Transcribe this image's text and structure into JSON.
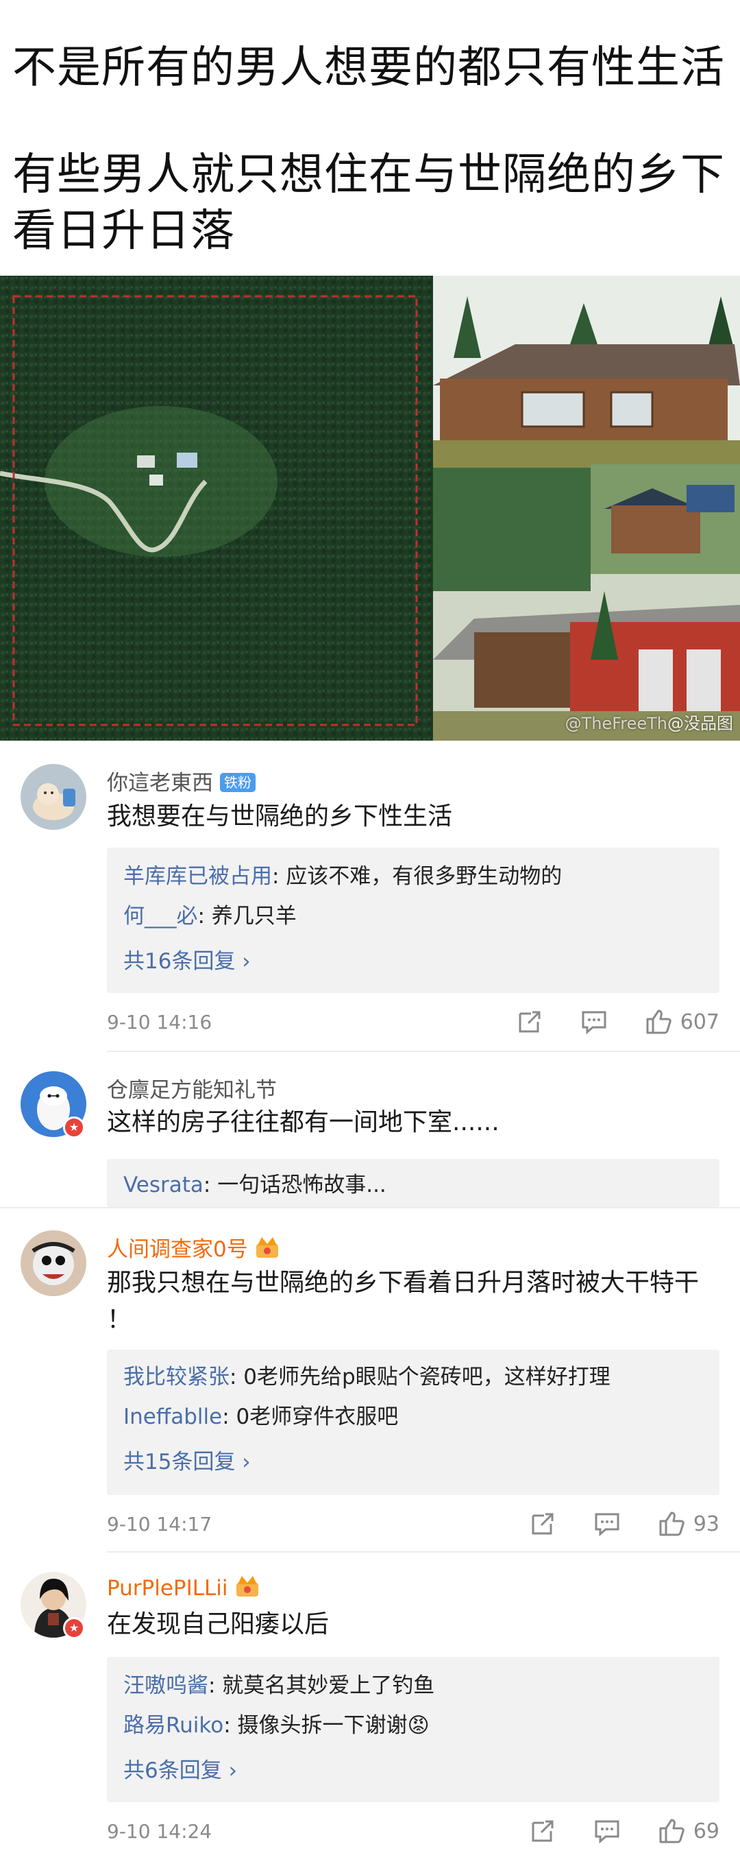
{
  "post": {
    "title_line1": "不是所有的男人想要的都只有性生活",
    "title_line2": "有些男人就只想住在与世隔绝的乡下",
    "title_line3": "看日升日落",
    "watermark_prefix": "@TheFreeTh",
    "watermark_brand": "@没品图"
  },
  "comments": [
    {
      "user": "你這老東西",
      "badge": "铁粉",
      "text": "我想要在与世隔绝的乡下性生活",
      "replies": [
        {
          "user": "羊库库已被占用",
          "text": ": 应该不难，有很多野生动物的"
        },
        {
          "user": "何___必",
          "text": ": 养几只羊"
        }
      ],
      "more": "共16条回复 ›",
      "time": "9-10 14:16",
      "likes": "607"
    },
    {
      "user": "仓廪足方能知礼节",
      "text": "这样的房子往往都有一间地下室......",
      "replies": [
        {
          "user": "Vesrata",
          "text": ": 一句话恐怖故事..."
        }
      ]
    },
    {
      "user": "人间调查家0号",
      "text": "那我只想在与世隔绝的乡下看着日升月落时被大干特干 ！",
      "replies": [
        {
          "user": "我比较紧张",
          "text": ": 0老师先给p眼贴个瓷砖吧，这样好打理"
        },
        {
          "user": "Ineffablle",
          "text": ": 0老师穿件衣服吧"
        }
      ],
      "more": "共15条回复 ›",
      "time": "9-10 14:17",
      "likes": "93"
    },
    {
      "user": "PurPlePILLii",
      "text": "在发现自己阳痿以后",
      "replies": [
        {
          "user": "汪嗷呜酱",
          "text": ": 就莫名其妙爱上了钓鱼"
        },
        {
          "user": "路易Ruiko",
          "text": ": 摄像头拆一下谢谢😡"
        }
      ],
      "more": "共6条回复 ›",
      "time": "9-10 14:24",
      "likes": "69"
    }
  ],
  "icons": {
    "share": "share-icon",
    "comment": "comment-icon",
    "like": "thumbs-up-icon"
  },
  "colors": {
    "reply_user": "#4a6ea9",
    "hot_user": "#f16b0b",
    "fan_badge": "#4a9cf0"
  }
}
